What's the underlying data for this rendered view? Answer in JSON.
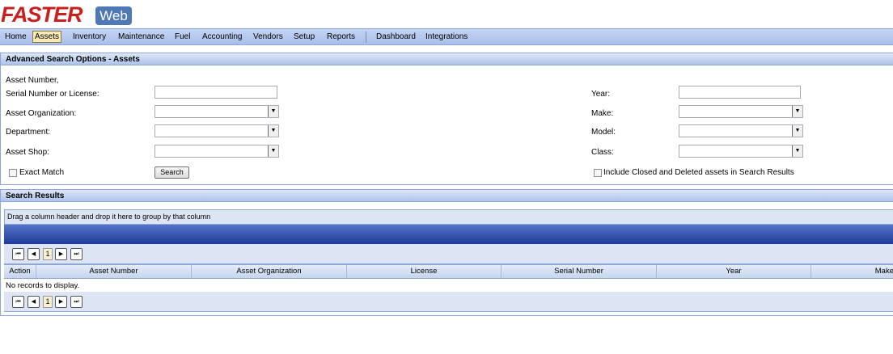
{
  "logo": {
    "brand": "FASTER",
    "suffix": "Web"
  },
  "menu": {
    "home": "Home",
    "assets": "Assets",
    "inventory": "Inventory",
    "maintenance": "Maintenance",
    "fuel": "Fuel",
    "accounting": "Accounting",
    "vendors": "Vendors",
    "setup": "Setup",
    "reports": "Reports",
    "dashboard": "Dashboard",
    "integrations": "Integrations",
    "active": "Assets"
  },
  "search_panel": {
    "title": "Advanced Search Options - Assets",
    "asset_number_label_line1": "Asset Number,",
    "asset_number_label_line2": "Serial Number or License:",
    "asset_number_value": "",
    "asset_org_label": "Asset Organization:",
    "asset_org_value": "",
    "department_label": "Department:",
    "department_value": "",
    "asset_shop_label": "Asset Shop:",
    "asset_shop_value": "",
    "exact_match_label": "Exact Match",
    "exact_match_checked": false,
    "search_button": "Search",
    "year_label": "Year:",
    "year_value": "",
    "make_label": "Make:",
    "make_value": "",
    "model_label": "Model:",
    "model_value": "",
    "class_label": "Class:",
    "class_value": "",
    "include_closed_label": "Include Closed and Deleted assets in Search Results",
    "include_closed_checked": false
  },
  "results_panel": {
    "title": "Search Results",
    "group_hint": "Drag a column header and drop it here to group by that column",
    "page_number": "1",
    "columns": [
      "Action",
      "Asset Number",
      "Asset Organization",
      "License",
      "Serial Number",
      "Year",
      "Make"
    ],
    "empty_text": "No records to display."
  }
}
